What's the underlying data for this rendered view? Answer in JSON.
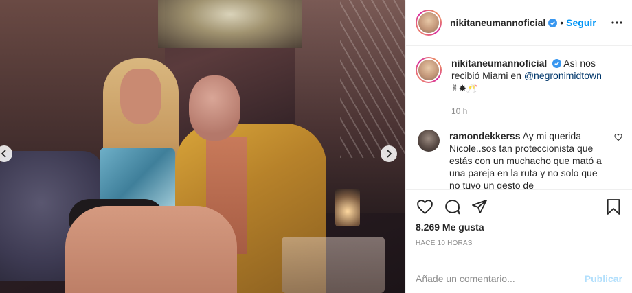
{
  "post": {
    "author": {
      "username": "nikitaneumannoficial",
      "verified_icon": "verified-badge-icon",
      "follow_separator": "•",
      "follow_label": "Seguir"
    },
    "caption": {
      "username": "nikitaneumannoficial",
      "text": "Así nos recibió Miami en",
      "mention": "@negronimidtown",
      "emojis": "✌✸🥂",
      "time": "10 h"
    },
    "comments": [
      {
        "username": "ramondekkerss",
        "text": "Ay mi querida Nicole..sos tan proteccionista que estás con un muchacho que mató a una pareja en la ruta y no solo que no tuvo un gesto de"
      }
    ],
    "likes": "8.269 Me gusta",
    "posted_ago": "HACE 10 HORAS",
    "comment_input": {
      "placeholder": "Añade un comentario...",
      "publish_label": "Publicar"
    }
  },
  "colors": {
    "link_blue": "#0095f6",
    "mention_blue": "#00376b",
    "publish_disabled": "#b2dffc",
    "muted_text": "#8e8e8e"
  },
  "icons": [
    "chevron-left-icon",
    "chevron-right-icon",
    "more-icon",
    "heart-icon",
    "comment-icon",
    "share-icon",
    "bookmark-icon",
    "heart-small-icon"
  ]
}
